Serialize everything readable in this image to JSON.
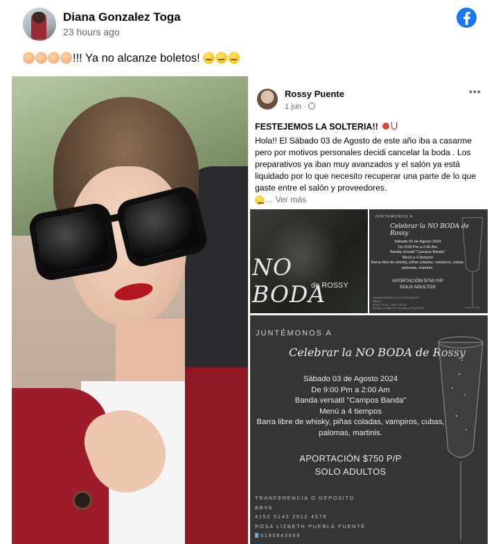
{
  "post": {
    "author": "Diana Gonzalez Toga",
    "time": "23 hours ago",
    "caption_text": "!!! Ya no alcanze boletos!",
    "caption_emojis": [
      "clapping-hands",
      "clapping-hands",
      "clapping-hands",
      "clapping-hands",
      "tired-face",
      "tired-face",
      "tired-face"
    ],
    "brand_color": "#1877f2"
  },
  "shared_post": {
    "author": "Rossy Puente",
    "time": "1 jun ·",
    "more": "•••",
    "title": "FESTEJEMOS LA SOLTERIA!!",
    "body": "Hola!! El Sábado 03 de Agosto de este año iba a casarme pero por motivos personales decidi cancelar la boda . Los preparativos ya iban muy avanzados y el salón ya está liquidado por lo que necesito recuperar una parte de lo que gaste entre el salón y proveedores.",
    "see_more": "… Ver más"
  },
  "flyer_left": {
    "title": "NO BODA",
    "subtitle": "de ROSSY"
  },
  "flyer": {
    "intro": "JUNTÉMONOS A",
    "headline": "Celebrar la NO BODA de Rossy",
    "lines": [
      "Sábado 03 de Agosto 2024",
      "De 9:00 Pm a 2:00 Am",
      "Banda versatil \"Campos Banda\"",
      "Menú a 4 tiempos",
      "Barra libre de whisky, piñas coladas, vampiros, cubas,",
      "palomas, martinis."
    ],
    "contribution": "APORTACIÓN $750 P/P",
    "adults": "SOLO ADULTOS",
    "footer": [
      "TRANFERENCIA O DEPOSITO",
      "BBVA",
      "4152 5142 2912 4578",
      "ROSA LIZBETH PUEBLA PUENTE",
      "6180843659"
    ]
  }
}
